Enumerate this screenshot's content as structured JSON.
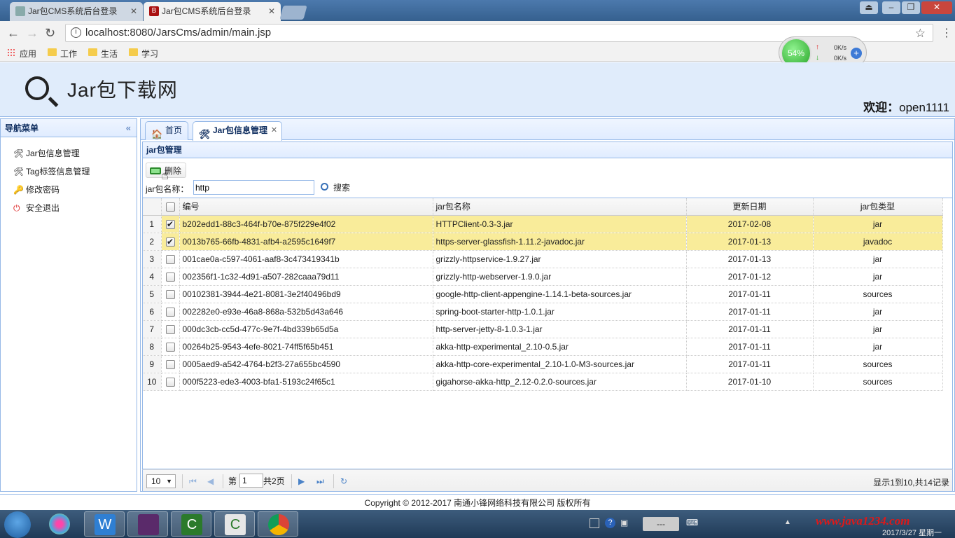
{
  "browser": {
    "tabs": [
      {
        "title": "Jar包CMS系统后台登录"
      },
      {
        "title": "Jar包CMS系统后台登录"
      }
    ],
    "url": "localhost:8080/JarsCms/admin/main.jsp",
    "bookmarks": [
      "应用",
      "工作",
      "生活",
      "学习"
    ]
  },
  "netwidget": {
    "percent": "54%",
    "up": "0K/s",
    "down": "0K/s"
  },
  "header": {
    "site_title": "Jar包下载网",
    "welcome_label": "欢迎：",
    "username": "open1111"
  },
  "nav": {
    "title": "导航菜单",
    "items": [
      {
        "label": "Jar包信息管理",
        "icon": "wrench-icon"
      },
      {
        "label": "Tag标签信息管理",
        "icon": "wrench-icon"
      },
      {
        "label": "修改密码",
        "icon": "key-icon"
      },
      {
        "label": "安全退出",
        "icon": "exit-icon"
      }
    ]
  },
  "tabs": {
    "home": "首页",
    "jar": "Jar包信息管理"
  },
  "panel": {
    "title": "jar包管理"
  },
  "toolbar": {
    "delete_label": "删除",
    "search_label": "jar包名称：",
    "search_value": "http",
    "search_button": "搜索"
  },
  "table": {
    "headers": [
      "编号",
      "jar包名称",
      "更新日期",
      "jar包类型"
    ],
    "rows": [
      {
        "n": "1",
        "checked": true,
        "id": "b202edd1-88c3-464f-b70e-875f229e4f02",
        "name": "HTTPClient-0.3-3.jar",
        "date": "2017-02-08",
        "type": "jar"
      },
      {
        "n": "2",
        "checked": true,
        "id": "0013b765-66fb-4831-afb4-a2595c1649f7",
        "name": "https-server-glassfish-1.11.2-javadoc.jar",
        "date": "2017-01-13",
        "type": "javadoc"
      },
      {
        "n": "3",
        "checked": false,
        "id": "001cae0a-c597-4061-aaf8-3c473419341b",
        "name": "grizzly-httpservice-1.9.27.jar",
        "date": "2017-01-13",
        "type": "jar"
      },
      {
        "n": "4",
        "checked": false,
        "id": "002356f1-1c32-4d91-a507-282caaa79d11",
        "name": "grizzly-http-webserver-1.9.0.jar",
        "date": "2017-01-12",
        "type": "jar"
      },
      {
        "n": "5",
        "checked": false,
        "id": "00102381-3944-4e21-8081-3e2f40496bd9",
        "name": "google-http-client-appengine-1.14.1-beta-sources.jar",
        "date": "2017-01-11",
        "type": "sources"
      },
      {
        "n": "6",
        "checked": false,
        "id": "002282e0-e93e-46a8-868a-532b5d43a646",
        "name": "spring-boot-starter-http-1.0.1.jar",
        "date": "2017-01-11",
        "type": "jar"
      },
      {
        "n": "7",
        "checked": false,
        "id": "000dc3cb-cc5d-477c-9e7f-4bd339b65d5a",
        "name": "http-server-jetty-8-1.0.3-1.jar",
        "date": "2017-01-11",
        "type": "jar"
      },
      {
        "n": "8",
        "checked": false,
        "id": "00264b25-9543-4efe-8021-74ff5f65b451",
        "name": "akka-http-experimental_2.10-0.5.jar",
        "date": "2017-01-11",
        "type": "jar"
      },
      {
        "n": "9",
        "checked": false,
        "id": "0005aed9-a542-4764-b2f3-27a655bc4590",
        "name": "akka-http-core-experimental_2.10-1.0-M3-sources.jar",
        "date": "2017-01-11",
        "type": "sources"
      },
      {
        "n": "10",
        "checked": false,
        "id": "000f5223-ede3-4003-bfa1-5193c24f65c1",
        "name": "gigahorse-akka-http_2.12-0.2.0-sources.jar",
        "date": "2017-01-10",
        "type": "sources"
      }
    ]
  },
  "pager": {
    "page_size": "10",
    "page_prefix": "第",
    "page": "1",
    "page_suffix": "共2页",
    "info": "显示1到10,共14记录"
  },
  "footer": {
    "copyright": "Copyright © 2012-2017 南通小锋网络科技有限公司 版权所有"
  },
  "taskbar": {
    "watermark": "www.java1234.com",
    "clock": "2017/3/27 星期一",
    "tray_text": "---"
  },
  "colors": {
    "selected_row": "#f9ec9a",
    "panel_border": "#95b8e7",
    "header_bg": "#e0ecfb"
  }
}
